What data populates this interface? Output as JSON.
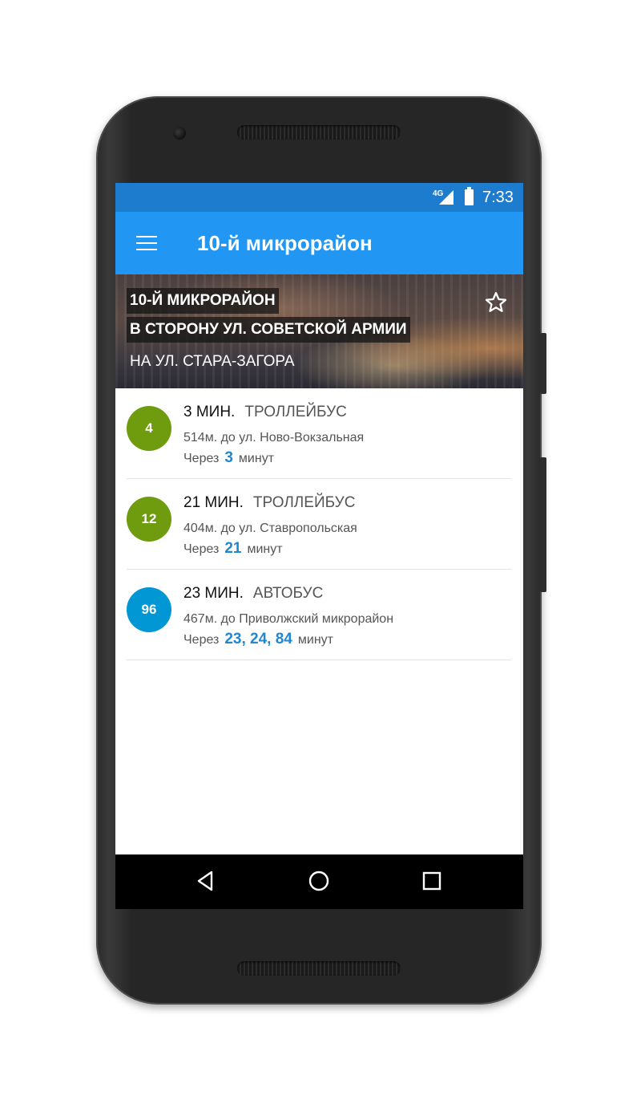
{
  "status_bar": {
    "network": "4G",
    "time": "7:33"
  },
  "app_bar": {
    "title": "10-й микрорайон",
    "menu_icon": "menu-icon"
  },
  "header": {
    "stop_name": "10-Й МИКРОРАЙОН",
    "direction": "В СТОРОНУ УЛ. СОВЕТСКОЙ АРМИИ",
    "street": "НА УЛ. СТАРА-ЗАГОРА",
    "favorite_icon": "star-outline-icon"
  },
  "arrivals": [
    {
      "route": "4",
      "route_color": "#6f9b0e",
      "minutes_label": "3 МИН.",
      "type": "ТРОЛЛЕЙБУС",
      "distance": "514м. до ул. Ново-Вокзальная",
      "eta_prefix": "Через",
      "eta_values": "3",
      "eta_suffix": "минут"
    },
    {
      "route": "12",
      "route_color": "#6f9b0e",
      "minutes_label": "21 МИН.",
      "type": "ТРОЛЛЕЙБУС",
      "distance": "404м. до ул. Ставропольская",
      "eta_prefix": "Через",
      "eta_values": "21",
      "eta_suffix": "минут"
    },
    {
      "route": "96",
      "route_color": "#0097d4",
      "minutes_label": "23 МИН.",
      "type": "АВТОБУС",
      "distance": "467м. до Приволжский микрорайон",
      "eta_prefix": "Через",
      "eta_values": "23,  24,  84",
      "eta_suffix": "минут"
    }
  ],
  "nav_bar": {
    "back_icon": "back-triangle-icon",
    "home_icon": "home-circle-icon",
    "recent_icon": "recent-square-icon"
  },
  "colors": {
    "status_bar": "#1e7ccf",
    "app_bar": "#2196f3",
    "eta_accent": "#1e88d2"
  }
}
